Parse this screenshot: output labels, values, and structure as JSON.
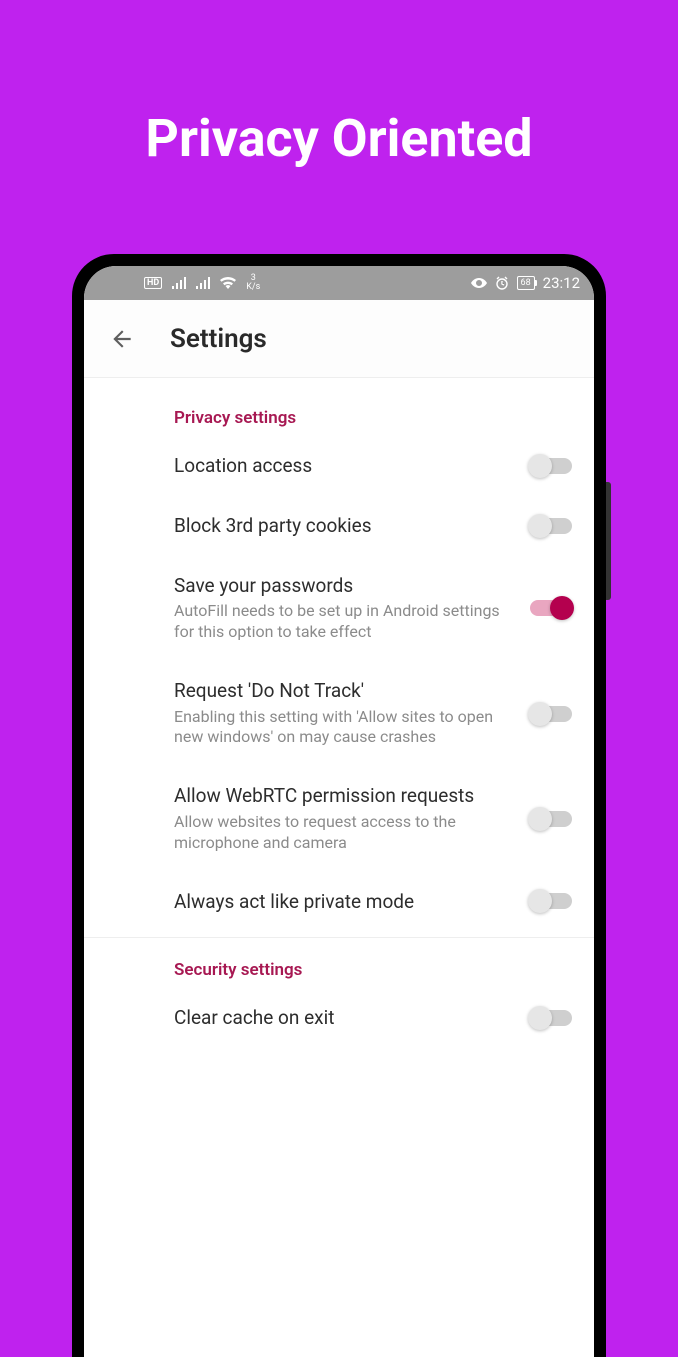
{
  "hero": {
    "title": "Privacy Oriented"
  },
  "status": {
    "hd_label": "HD",
    "net_speed_value": "3",
    "net_speed_unit": "K/s",
    "battery": "68",
    "time": "23:12"
  },
  "appbar": {
    "title": "Settings"
  },
  "sections": {
    "privacy": {
      "header": "Privacy settings",
      "location": {
        "title": "Location access",
        "on": false
      },
      "cookies": {
        "title": "Block 3rd party cookies",
        "on": false
      },
      "passwords": {
        "title": "Save your passwords",
        "sub": "AutoFill needs to be set up in Android settings for this option to take effect",
        "on": true
      },
      "dnt": {
        "title": "Request 'Do Not Track'",
        "sub": "Enabling this setting with 'Allow sites to open new windows' on may cause crashes",
        "on": false
      },
      "webrtc": {
        "title": "Allow WebRTC permission requests",
        "sub": "Allow websites to request access to the microphone and camera",
        "on": false
      },
      "private_mode": {
        "title": "Always act like private mode",
        "on": false
      }
    },
    "security": {
      "header": "Security settings",
      "clear_cache": {
        "title": "Clear cache on exit",
        "on": false
      }
    }
  }
}
